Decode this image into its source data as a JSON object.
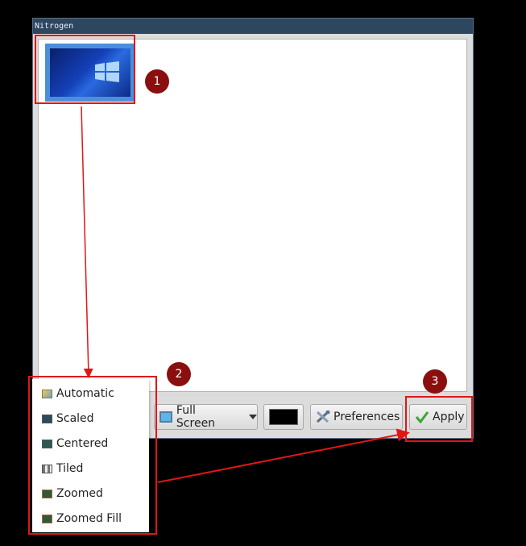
{
  "window": {
    "title": "Nitrogen"
  },
  "toolbar": {
    "mode_label": "Full Screen",
    "color_swatch": "#000000",
    "preferences_label": "Preferences",
    "apply_label": "Apply"
  },
  "dropdown": {
    "items": [
      {
        "label": "Automatic",
        "icon": "automatic-icon"
      },
      {
        "label": "Scaled",
        "icon": "scaled-icon"
      },
      {
        "label": "Centered",
        "icon": "centered-icon"
      },
      {
        "label": "Tiled",
        "icon": "tiled-icon"
      },
      {
        "label": "Zoomed",
        "icon": "zoomed-icon"
      },
      {
        "label": "Zoomed Fill",
        "icon": "zoomed-fill-icon"
      }
    ]
  },
  "annotations": {
    "steps": [
      "1",
      "2",
      "3"
    ],
    "color": "#e01616",
    "badge_color": "#8b0f0f"
  }
}
